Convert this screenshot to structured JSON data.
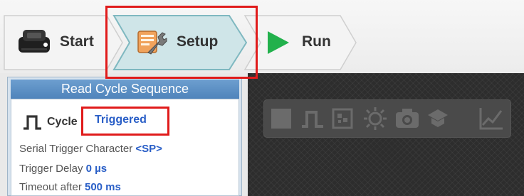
{
  "steps": [
    {
      "label": "Start",
      "icon": "camera-device-icon"
    },
    {
      "label": "Setup",
      "icon": "setup-wrench-icon"
    },
    {
      "label": "Run",
      "icon": "play-icon"
    }
  ],
  "panel": {
    "title": "Read Cycle Sequence",
    "cycle_label": "Cycle",
    "cycle_value": "Triggered",
    "serial_trigger_label": "Serial Trigger Character",
    "serial_trigger_value": "<SP>",
    "trigger_delay_label": "Trigger Delay",
    "trigger_delay_value": "0 µs",
    "timeout_label": "Timeout after",
    "timeout_value": "500 ms"
  },
  "toolbar_icons": [
    "image-view-icon",
    "cycle-pulse-icon",
    "symbol-icon",
    "light-icon",
    "camera-icon",
    "filter-icon",
    "chart-icon"
  ],
  "colors": {
    "accent_blue": "#2a5fc7",
    "highlight_red": "#e01b1b",
    "run_green": "#22b14c"
  }
}
